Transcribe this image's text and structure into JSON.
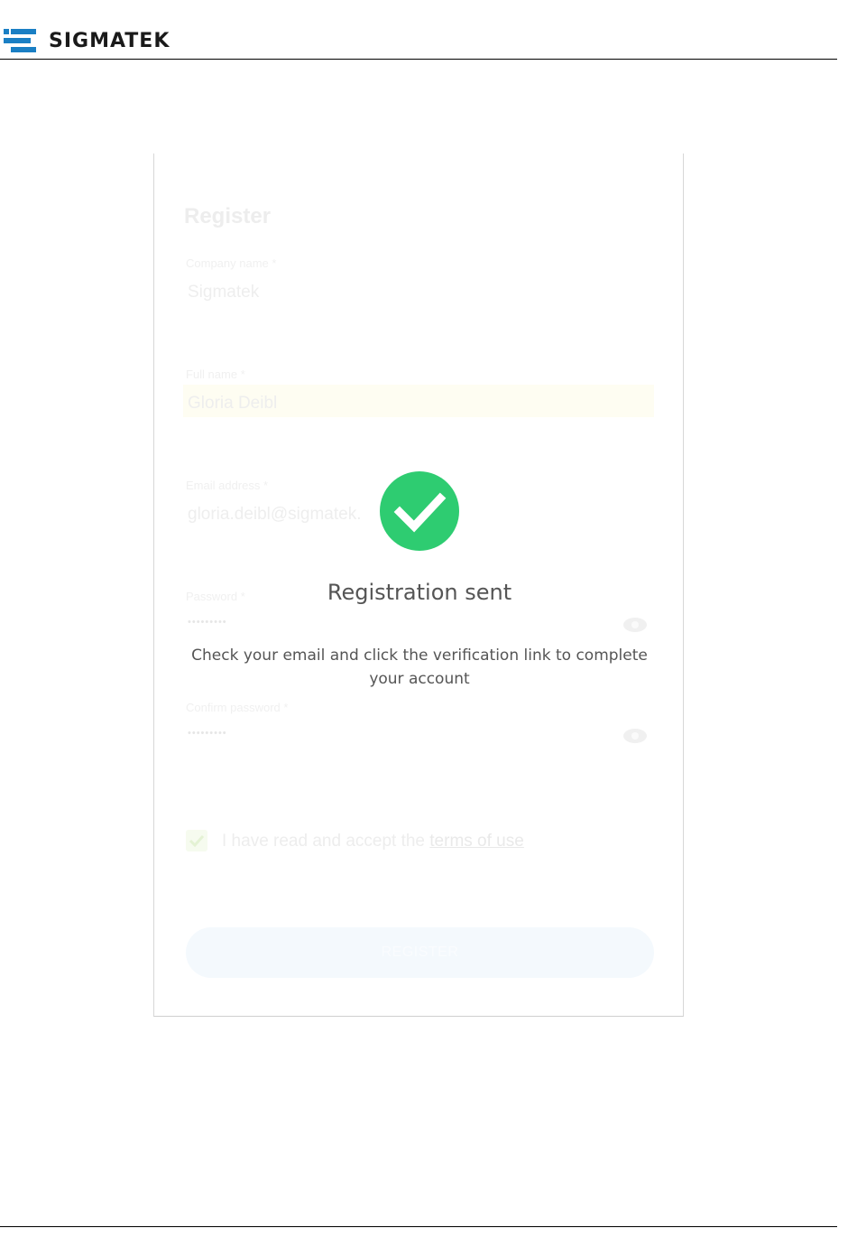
{
  "header": {
    "brand_name": "SIGMATEK"
  },
  "form": {
    "title": "Register",
    "company": {
      "label": "Company name *",
      "value": "Sigmatek"
    },
    "fullname": {
      "label": "Full name *",
      "value": "Gloria Deibl"
    },
    "email": {
      "label": "Email address *",
      "value": "gloria.deibl@sigmatek."
    },
    "password": {
      "label": "Password *",
      "value": "•••••••••"
    },
    "confirm": {
      "label": "Confirm password *",
      "value": "•••••••••"
    },
    "terms": {
      "text": "I have read and accept the ",
      "link": "terms of use",
      "checked": true
    },
    "submit_label": "REGISTER"
  },
  "overlay": {
    "title": "Registration sent",
    "message": "Check your email and click the verification link to complete your account",
    "icon": "check-circle-icon",
    "icon_color": "#2ecc71"
  }
}
